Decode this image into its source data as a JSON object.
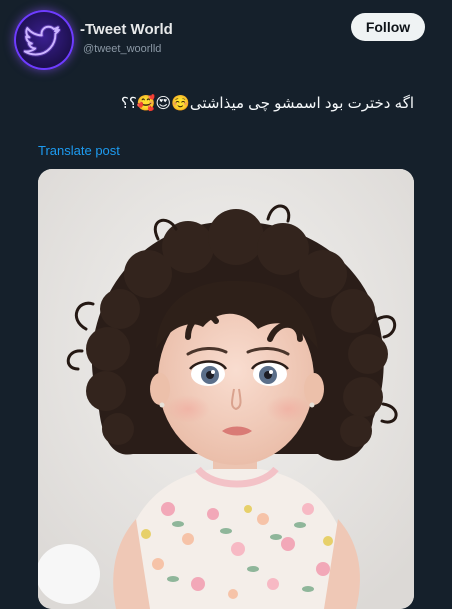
{
  "account": {
    "display_name": "-Tweet World",
    "handle": "@tweet_woorlld",
    "avatar_icon": "bird-logo-icon"
  },
  "actions": {
    "follow_label": "Follow"
  },
  "post": {
    "text": "اگه دخترت بود اسمشو چی میذاشتی☺️😍🥰؟؟",
    "translate_label": "Translate post",
    "media": {
      "type": "photo",
      "description_icon": "toddler-photo"
    }
  },
  "colors": {
    "background": "#15202b",
    "link": "#1d9bf0",
    "follow_button_bg": "#eff3f4",
    "avatar_glow": "#6e3cff"
  }
}
